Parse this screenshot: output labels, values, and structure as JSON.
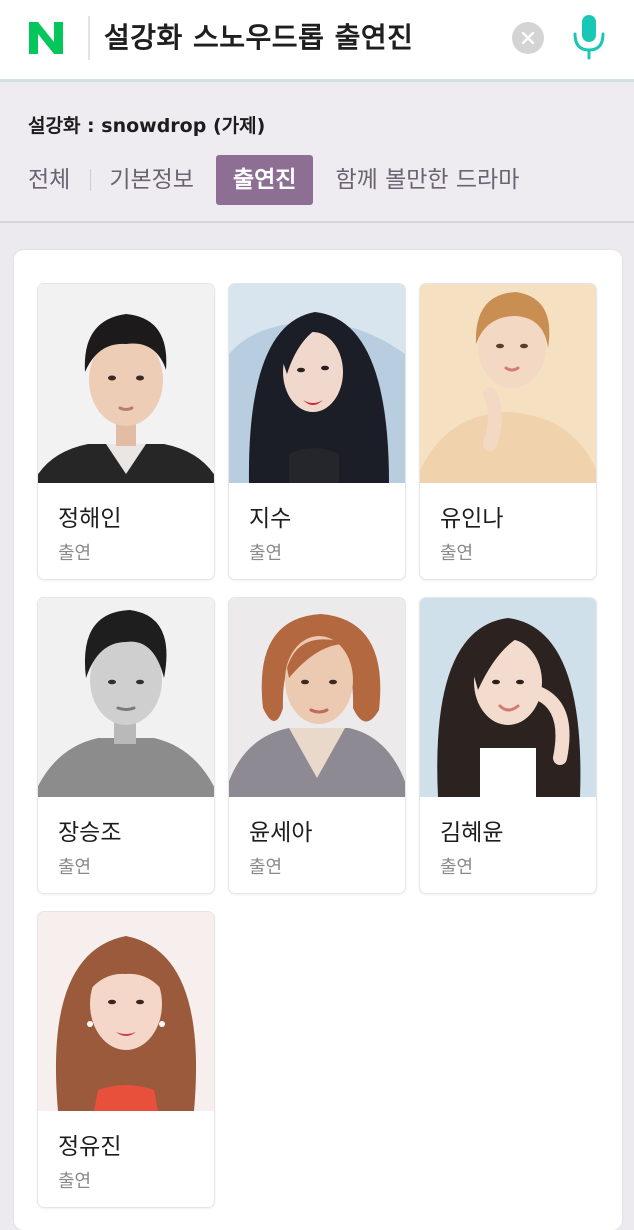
{
  "search": {
    "query": "설강화 스노우드롭 출연진",
    "logo_text": "N",
    "clear_icon": "close-icon",
    "mic_icon": "microphone-icon"
  },
  "info": {
    "title": "설강화 : snowdrop (가제)",
    "tabs": [
      {
        "label": "전체",
        "active": false
      },
      {
        "label": "기본정보",
        "active": false
      },
      {
        "label": "출연진",
        "active": true
      },
      {
        "label": "함께 볼만한 드라마",
        "active": false
      }
    ]
  },
  "cast": [
    {
      "name": "정해인",
      "role": "출연"
    },
    {
      "name": "지수",
      "role": "출연"
    },
    {
      "name": "유인나",
      "role": "출연"
    },
    {
      "name": "장승조",
      "role": "출연"
    },
    {
      "name": "윤세아",
      "role": "출연"
    },
    {
      "name": "김혜윤",
      "role": "출연"
    },
    {
      "name": "정유진",
      "role": "출연"
    }
  ],
  "colors": {
    "brand_green": "#03c75a",
    "active_tab": "#8e6f94",
    "mic": "#19c8b4"
  }
}
